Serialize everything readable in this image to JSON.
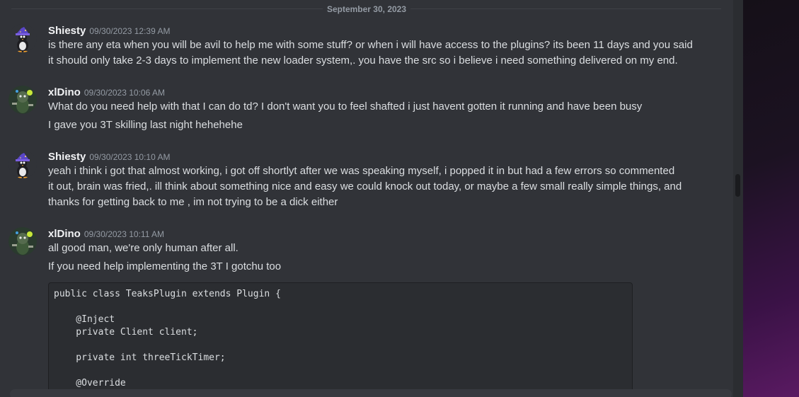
{
  "date_divider": "September 30, 2023",
  "messages": [
    {
      "author": "Shiesty",
      "timestamp": "09/30/2023 12:39 AM",
      "lines": [
        "is there any eta when you will be avil to help me with some stuff? or when i will have access to the plugins? its been 11 days and you said",
        "it should only take 2-3 days to implement the new loader system,. you have the src so i believe i need something delivered on my end."
      ]
    },
    {
      "author": "xlDino",
      "timestamp": "09/30/2023 10:06 AM",
      "lines": [
        "What do you need help with that I can do td? I don't want you to feel shafted i just havent gotten it running and have been busy",
        "I gave you 3T skilling last night hehehehe"
      ]
    },
    {
      "author": "Shiesty",
      "timestamp": "09/30/2023 10:10 AM",
      "lines": [
        "yeah i think i got that almost working, i got off shortlyt after we was speaking myself, i popped it in but had a few errors so commented",
        "it out, brain was fried,. ill think about something nice and easy we could knock out today, or maybe a few small really simple things, and",
        "thanks for getting back to me , im not trying to be a dick either"
      ]
    },
    {
      "author": "xlDino",
      "timestamp": "09/30/2023 10:11 AM",
      "lines": [
        "all good man, we're only human after all.",
        "If you need help implementing the 3T I gotchu too"
      ],
      "code": [
        "public class TeaksPlugin extends Plugin {",
        "",
        "    @Inject",
        "    private Client client;",
        "",
        "    private int threeTickTimer;",
        "",
        "    @Override"
      ]
    }
  ],
  "colors": {
    "background": "#313338",
    "text": "#dbdee1",
    "username": "#f2f3f5",
    "timestamp": "#949ba4"
  },
  "icons": {
    "shiesty_avatar": "penguin-wizard-avatar",
    "xldino_avatar": "dino-character-avatar"
  }
}
